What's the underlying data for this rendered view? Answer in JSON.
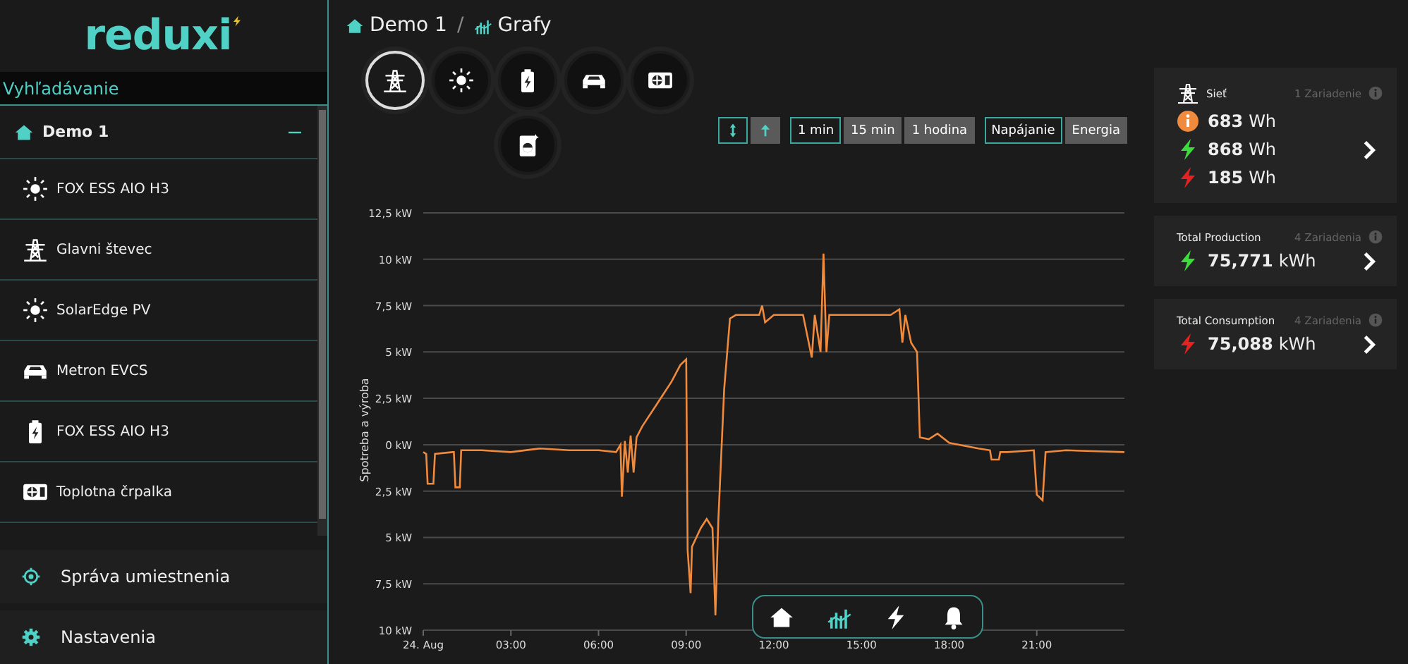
{
  "brand": {
    "name": "reduxi"
  },
  "search": {
    "placeholder": "Vyhľadávanie"
  },
  "tree": [
    {
      "label": "Demo 1",
      "kind": "home",
      "expanded": true,
      "children": [
        {
          "label": "FOX ESS AIO H3",
          "kind": "sun"
        },
        {
          "label": "Glavni števec",
          "kind": "grid"
        },
        {
          "label": "SolarEdge PV",
          "kind": "sun"
        },
        {
          "label": "Metron EVCS",
          "kind": "car"
        },
        {
          "label": "FOX ESS AIO H3",
          "kind": "battery"
        },
        {
          "label": "Toplotna črpalka",
          "kind": "heatpump"
        }
      ]
    }
  ],
  "sidebar_menu": [
    {
      "label": "Správa umiestnenia",
      "kind": "target"
    },
    {
      "label": "Nastavenia",
      "kind": "gear"
    }
  ],
  "breadcrumb": [
    {
      "label": "Demo 1",
      "kind": "home"
    },
    {
      "label": "Grafy",
      "kind": "chart"
    }
  ],
  "devices": [
    {
      "kind": "grid",
      "selected": true
    },
    {
      "kind": "sun",
      "selected": false
    },
    {
      "kind": "battery",
      "selected": false
    },
    {
      "kind": "car",
      "selected": false
    },
    {
      "kind": "heatpump",
      "selected": false
    },
    {
      "kind": "washer",
      "selected": false
    }
  ],
  "axis_toggles": [
    {
      "kind": "updown",
      "selected": true
    },
    {
      "kind": "up",
      "selected": false
    }
  ],
  "intervals": [
    {
      "label": "1 min",
      "selected": true
    },
    {
      "label": "15 min",
      "selected": false
    },
    {
      "label": "1 hodina",
      "selected": false
    }
  ],
  "modes": [
    {
      "label": "Napájanie",
      "selected": true
    },
    {
      "label": "Energia",
      "selected": false
    }
  ],
  "breadcrumb_separator": "/",
  "chart": {
    "chart_data": {
      "type": "line",
      "grid": true,
      "ylabel": "Spotreba a výroba",
      "xlim": [
        0,
        24
      ],
      "ylim": [
        -10,
        12.5
      ],
      "xticks": [
        {
          "value": 0,
          "label": "24. Aug"
        },
        {
          "value": 3,
          "label": "03:00"
        },
        {
          "value": 6,
          "label": "06:00"
        },
        {
          "value": 9,
          "label": "09:00"
        },
        {
          "value": 12,
          "label": "12:00"
        },
        {
          "value": 15,
          "label": "15:00"
        },
        {
          "value": 18,
          "label": "18:00"
        },
        {
          "value": 21,
          "label": "21:00"
        }
      ],
      "yticks": [
        {
          "value": 12.5,
          "label": "12,5 kW"
        },
        {
          "value": 10,
          "label": "10 kW"
        },
        {
          "value": 7.5,
          "label": "7,5 kW"
        },
        {
          "value": 5,
          "label": "5 kW"
        },
        {
          "value": 2.5,
          "label": "2,5 kW"
        },
        {
          "value": 0,
          "label": "0 kW"
        },
        {
          "value": -2.5,
          "label": "2,5 kW"
        },
        {
          "value": -5,
          "label": "5 kW"
        },
        {
          "value": -7.5,
          "label": "7,5 kW"
        },
        {
          "value": -10,
          "label": "10 kW"
        }
      ],
      "x": [
        0,
        0.1,
        0.15,
        0.35,
        0.4,
        1,
        1.05,
        1.1,
        1.25,
        1.3,
        2,
        3,
        4,
        5,
        6,
        6.6,
        6.75,
        6.8,
        6.9,
        7,
        7.1,
        7.2,
        7.3,
        7.5,
        8,
        8.5,
        8.8,
        9,
        9.05,
        9.15,
        9.2,
        9.5,
        9.7,
        9.9,
        10,
        10.1,
        10.3,
        10.5,
        10.7,
        11.5,
        11.6,
        11.7,
        12,
        13,
        13.3,
        13.4,
        13.6,
        13.7,
        13.8,
        13.9,
        14,
        15,
        16,
        16.3,
        16.4,
        16.5,
        16.7,
        16.9,
        17,
        17.3,
        17.6,
        18,
        19,
        19.4,
        19.45,
        19.7,
        19.75,
        20,
        20.9,
        21,
        21.2,
        21.3,
        22,
        24
      ],
      "series": [
        {
          "color": "#f08a3c",
          "values": [
            -0.4,
            -0.5,
            -2.1,
            -2.1,
            -0.5,
            -0.4,
            -0.4,
            -2.3,
            -2.3,
            -0.3,
            -0.3,
            -0.4,
            -0.2,
            -0.3,
            -0.3,
            -0.4,
            0,
            -2.8,
            0.2,
            -1.5,
            0.5,
            -1.5,
            0.4,
            1,
            2.2,
            3.4,
            4.3,
            4.6,
            -5.7,
            -8,
            -5.5,
            -4.5,
            -4,
            -4.5,
            -9.2,
            -4,
            3,
            6.8,
            7,
            7,
            7.5,
            6.6,
            7,
            7,
            4.7,
            7,
            5,
            10.3,
            5,
            7,
            7,
            7,
            7,
            7.3,
            5.5,
            7,
            5.5,
            5,
            0.4,
            0.3,
            0.6,
            0.1,
            -0.2,
            -0.3,
            -0.8,
            -0.8,
            -0.4,
            -0.4,
            -0.3,
            -2.7,
            -3,
            -0.4,
            -0.3,
            -0.4
          ]
        }
      ]
    }
  },
  "cards": [
    {
      "title": "Sieť",
      "kind": "grid",
      "devices": "1 Zariadenie",
      "rows": [
        {
          "kind": "info",
          "color": "#f08a3c",
          "value": "683",
          "unit": "Wh"
        },
        {
          "kind": "bolt",
          "color": "#3ddc3d",
          "value": "868",
          "unit": "Wh"
        },
        {
          "kind": "bolt",
          "color": "#e52222",
          "value": "185",
          "unit": "Wh"
        }
      ]
    },
    {
      "title": "Total Production",
      "kind": "none",
      "devices": "4 Zariadenia",
      "rows": [
        {
          "kind": "bolt",
          "color": "#3ddc3d",
          "value": "75,771",
          "unit": "kWh"
        }
      ]
    },
    {
      "title": "Total Consumption",
      "kind": "none",
      "devices": "4 Zariadenia",
      "rows": [
        {
          "kind": "bolt",
          "color": "#e52222",
          "value": "75,088",
          "unit": "kWh"
        }
      ]
    }
  ],
  "bottom_nav": [
    {
      "kind": "home",
      "selected": false
    },
    {
      "kind": "chart",
      "selected": true
    },
    {
      "kind": "bolt",
      "selected": false
    },
    {
      "kind": "bell",
      "selected": false
    }
  ]
}
